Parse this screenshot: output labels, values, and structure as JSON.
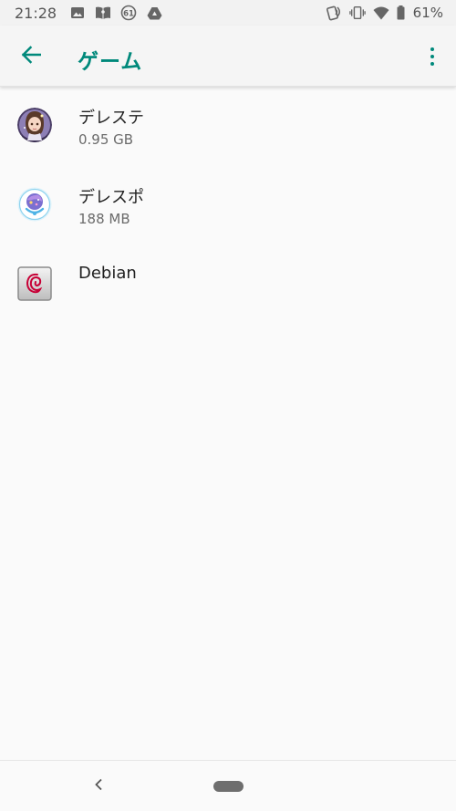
{
  "status_bar": {
    "time": "21:28",
    "notification_icons": [
      "image-icon",
      "book-icon",
      "badge-61-icon",
      "drive-icon"
    ],
    "badge_number": "61",
    "system_icons": [
      "nfc-icon",
      "vibrate-icon",
      "wifi-icon",
      "battery-icon"
    ],
    "battery": "61%"
  },
  "app_bar": {
    "title": "ゲーム",
    "accent_color": "#00897b"
  },
  "apps": [
    {
      "name": "デレステ",
      "size": "0.95 GB",
      "icon": "deresute-app-icon"
    },
    {
      "name": "デレスポ",
      "size": "188 MB",
      "icon": "deresupo-app-icon"
    },
    {
      "name": "Debian",
      "size": "",
      "icon": "debian-app-icon"
    }
  ],
  "nav_bar": {
    "back_icon": "nav-back-icon",
    "home_icon": "nav-home-pill"
  }
}
